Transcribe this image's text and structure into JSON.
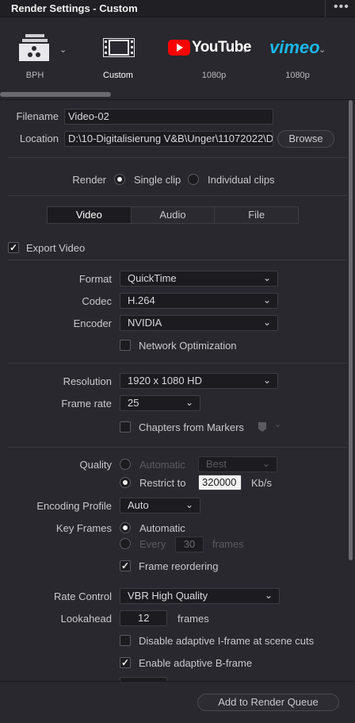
{
  "window": {
    "title": "Render Settings - Custom",
    "menu_icon": "more-icon"
  },
  "presets": [
    {
      "label": "BPH",
      "icon": "resolve-logo-icon",
      "active": false
    },
    {
      "label": "Custom",
      "icon": "film-strip-icon",
      "active": true
    },
    {
      "label": "1080p",
      "icon": "youtube-logo-icon",
      "logo_text": "YouTube",
      "active": false
    },
    {
      "label": "1080p",
      "icon": "vimeo-logo-icon",
      "logo_text": "vimeo",
      "active": false
    }
  ],
  "file": {
    "filename_label": "Filename",
    "filename_value": "Video-02",
    "location_label": "Location",
    "location_value": "D:\\10-Digitalisierung V&B\\Unger\\11072022\\D",
    "browse_label": "Browse"
  },
  "render": {
    "label": "Render",
    "single_clip": "Single clip",
    "individual_clips": "Individual clips"
  },
  "tabs": [
    {
      "label": "Video",
      "active": true
    },
    {
      "label": "Audio",
      "active": false
    },
    {
      "label": "File",
      "active": false
    }
  ],
  "video": {
    "export_video": "Export Video",
    "format_label": "Format",
    "format_value": "QuickTime",
    "codec_label": "Codec",
    "codec_value": "H.264",
    "encoder_label": "Encoder",
    "encoder_value": "NVIDIA",
    "network_opt": "Network Optimization",
    "resolution_label": "Resolution",
    "resolution_value": "1920 x 1080 HD",
    "framerate_label": "Frame rate",
    "framerate_value": "25",
    "chapters": "Chapters from Markers",
    "quality_label": "Quality",
    "quality_automatic": "Automatic",
    "quality_best": "Best",
    "restrict_to": "Restrict to",
    "restrict_value": "320000",
    "restrict_unit": "Kb/s",
    "encoding_profile_label": "Encoding Profile",
    "encoding_profile_value": "Auto",
    "key_frames_label": "Key Frames",
    "key_automatic": "Automatic",
    "key_every": "Every",
    "key_every_value": "30",
    "key_frames_unit": "frames",
    "frame_reordering": "Frame reordering",
    "rate_control_label": "Rate Control",
    "rate_control_value": "VBR High Quality",
    "lookahead_label": "Lookahead",
    "lookahead_value": "12",
    "lookahead_unit": "frames",
    "disable_adaptive_i": "Disable adaptive I-frame at scene cuts",
    "enable_adaptive_b": "Enable adaptive B-frame"
  },
  "footer": {
    "add_to_queue": "Add to Render Queue"
  }
}
